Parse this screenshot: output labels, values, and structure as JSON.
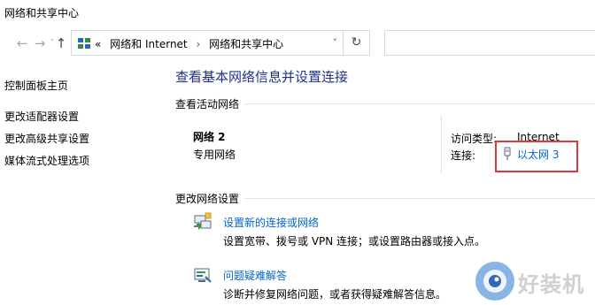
{
  "window": {
    "title": "网络和共享中心"
  },
  "navigation": {
    "back_icon": "arrow-left-icon",
    "forward_icon": "arrow-right-icon",
    "recent_icon": "chevron-down-icon",
    "up_icon": "arrow-up-icon",
    "overflow": "«",
    "breadcrumbs": [
      "网络和 Internet",
      "网络和共享中心"
    ],
    "breadcrumb_separator": "›",
    "refresh_icon": "refresh-icon"
  },
  "sidebar": {
    "items": [
      {
        "label": "控制面板主页"
      },
      {
        "label": "更改适配器设置"
      },
      {
        "label": "更改高级共享设置"
      },
      {
        "label": "媒体流式处理选项"
      }
    ]
  },
  "main": {
    "heading": "查看基本网络信息并设置连接",
    "active_section_label": "查看活动网络",
    "network": {
      "name": "网络 2",
      "type": "专用网络",
      "access_type_label": "访问类型:",
      "access_type_value": "Internet",
      "connection_label": "连接:",
      "connection_value": "以太网 3"
    },
    "change_section_label": "更改网络设置",
    "tasks": [
      {
        "icon": "new-connection-icon",
        "link": "设置新的连接或网络",
        "description": "设置宽带、拨号或 VPN 连接；或设置路由器或接入点。"
      },
      {
        "icon": "troubleshoot-icon",
        "link": "问题疑难解答",
        "description": "诊断并修复网络问题，或者获得疑难解答信息。"
      }
    ]
  },
  "watermark": {
    "text": "好装机"
  },
  "colors": {
    "link": "#0066cc",
    "heading": "#1e3287",
    "highlight": "#e0383d"
  }
}
